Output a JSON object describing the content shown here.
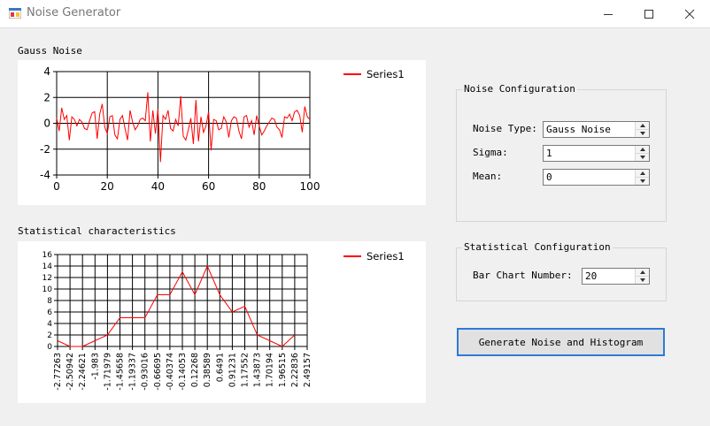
{
  "window": {
    "title": "Noise Generator",
    "controls": {
      "minimize": "—",
      "maximize": "☐",
      "close": "✕"
    }
  },
  "noise_section": {
    "label": "Gauss Noise"
  },
  "stats_section": {
    "label": "Statistical characteristics"
  },
  "noise_config": {
    "title": "Noise Configuration",
    "noise_type_label": "Noise Type:",
    "noise_type_value": "Gauss Noise",
    "sigma_label": "Sigma:",
    "sigma_value": "1",
    "mean_label": "Mean:",
    "mean_value": "0"
  },
  "stat_config": {
    "title": "Statistical Configuration",
    "bar_count_label": "Bar Chart Number:",
    "bar_count_value": "20"
  },
  "generate_button": {
    "label": "Generate Noise and Histogram"
  },
  "colors": {
    "series": "#ff0000",
    "accent": "#2f7ad5"
  },
  "chart_data": [
    {
      "type": "line",
      "legend": [
        "Series1"
      ],
      "legend_position": "top-right",
      "grid": true,
      "xlim": [
        0,
        100
      ],
      "ylim": [
        -4,
        4
      ],
      "x_ticks": [
        0,
        20,
        40,
        60,
        80,
        100
      ],
      "y_ticks": [
        -4,
        -2,
        0,
        2,
        4
      ],
      "series": [
        {
          "name": "Series1",
          "values": [
            0.4,
            -0.6,
            1.2,
            0.3,
            0.6,
            -1.3,
            0.5,
            0.3,
            -0.2,
            0.3,
            0.1,
            -0.4,
            -0.5,
            0.2,
            0.8,
            0.9,
            -1.2,
            0.7,
            1.5,
            -0.3,
            -0.8,
            0.5,
            0.6,
            -0.9,
            -1.2,
            0.3,
            0.6,
            -0.4,
            -1.3,
            1.0,
            0.1,
            -0.5,
            -0.2,
            0.3,
            0.4,
            0.2,
            2.4,
            -1.4,
            1.0,
            -0.8,
            1.1,
            -3.0,
            0.6,
            0.3,
            1.0,
            -0.4,
            -0.6,
            0.3,
            -0.2,
            2.1,
            -1.0,
            -1.3,
            -0.5,
            0.4,
            -1.6,
            1.8,
            -1.4,
            0.5,
            -0.7,
            -0.2,
            0.9,
            -2.1,
            0.3,
            0.2,
            -0.5,
            -0.4,
            0.5,
            0.1,
            -1.1,
            0.2,
            0.5,
            0.4,
            -0.6,
            -1.2,
            0.5,
            0.6,
            -0.3,
            0.2,
            -0.9,
            0.6,
            -0.2,
            -0.9,
            -0.6,
            -0.2,
            0.1,
            0.4,
            0.3,
            -0.3,
            -0.5,
            -1.1,
            0.5,
            0.4,
            0.7,
            0.2,
            0.9,
            1.0,
            0.6,
            -0.7,
            1.3,
            0.5,
            0.3
          ]
        }
      ]
    },
    {
      "type": "line",
      "legend": [
        "Series1"
      ],
      "legend_position": "top-right",
      "grid": true,
      "ylim": [
        0,
        16
      ],
      "y_ticks": [
        0,
        2,
        4,
        6,
        8,
        10,
        12,
        14,
        16
      ],
      "categories": [
        "-2.77263",
        "-2.50942",
        "-2.24621",
        "-1.983",
        "-1.71979",
        "-1.45658",
        "-1.19337",
        "-0.93016",
        "-0.66695",
        "-0.40374",
        "-0.14053",
        "0.12268",
        "0.38589",
        "0.6491",
        "0.91231",
        "1.17552",
        "1.43873",
        "1.70194",
        "1.96515",
        "2.22836",
        "2.49157"
      ],
      "series": [
        {
          "name": "Series1",
          "values": [
            1,
            0,
            0,
            1,
            2,
            5,
            5,
            5,
            9,
            9,
            13,
            9,
            14,
            9,
            6,
            7,
            2,
            1,
            0,
            2
          ]
        }
      ]
    }
  ]
}
